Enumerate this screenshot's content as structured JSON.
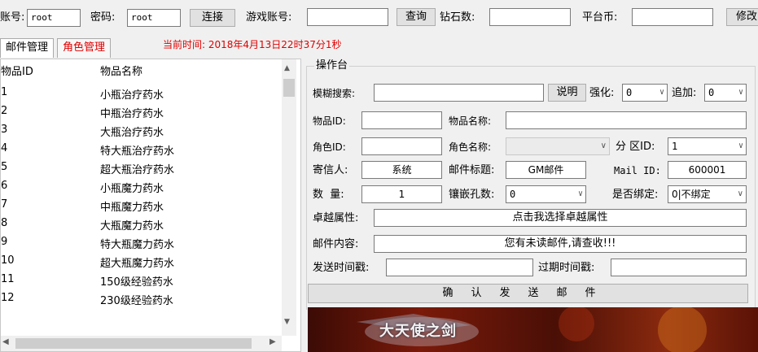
{
  "toolbar": {
    "account_label": "账号:",
    "account_value": "root",
    "password_label": "密码:",
    "password_value": "root",
    "connect_button": "连接",
    "game_account_label": "游戏账号:",
    "game_account_value": "",
    "query_button": "查询",
    "diamond_label": "钻石数:",
    "diamond_value": "",
    "platform_coin_label": "平台币:",
    "platform_coin_value": "",
    "modify_button": "修改"
  },
  "tabs": [
    {
      "label": "邮件管理",
      "active": true
    },
    {
      "label": "角色管理",
      "active": false
    }
  ],
  "current_time": "当前时间: 2018年4月13日22时37分1秒",
  "item_list": {
    "columns": [
      "物品ID",
      "物品名称"
    ],
    "rows": [
      [
        "1",
        "小瓶治疗药水"
      ],
      [
        "2",
        "中瓶治疗药水"
      ],
      [
        "3",
        "大瓶治疗药水"
      ],
      [
        "4",
        "特大瓶治疗药水"
      ],
      [
        "5",
        "超大瓶治疗药水"
      ],
      [
        "6",
        "小瓶魔力药水"
      ],
      [
        "7",
        "中瓶魔力药水"
      ],
      [
        "8",
        "大瓶魔力药水"
      ],
      [
        "9",
        "特大瓶魔力药水"
      ],
      [
        "10",
        "超大瓶魔力药水"
      ],
      [
        "11",
        "150级经验药水"
      ],
      [
        "12",
        "230级经验药水"
      ]
    ]
  },
  "ops": {
    "title": "操作台",
    "fuzzy_search_label": "模糊搜索:",
    "fuzzy_search_value": "",
    "explain_button": "说明",
    "enhance_label": "强化:",
    "enhance_value": "0",
    "append_label": "追加:",
    "append_value": "0",
    "item_id_label": "物品ID:",
    "item_id_value": "",
    "item_name_label": "物品名称:",
    "item_name_value": "",
    "role_id_label": "角色ID:",
    "role_id_value": "",
    "role_name_label": "角色名称:",
    "role_name_value": "",
    "zone_id_label": "分 区ID:",
    "zone_id_value": "1",
    "sender_label": "寄信人:",
    "sender_value": "系统",
    "mail_title_label": "邮件标题:",
    "mail_title_value": "GM邮件",
    "mail_id_label": "Mail ID:",
    "mail_id_value": "600001",
    "quantity_label": "数  量:",
    "quantity_value": "1",
    "socket_label": "镶嵌孔数:",
    "socket_value": "0",
    "bound_label": "是否绑定:",
    "bound_value": "0|不绑定",
    "excellent_label": "卓越属性:",
    "excellent_button": "点击我选择卓越属性",
    "mail_content_label": "邮件内容:",
    "mail_content_value": "您有未读邮件,请查收!!!",
    "send_time_label": "发送时间戳:",
    "send_time_value": "",
    "expire_time_label": "过期时间戳:",
    "expire_time_value": "",
    "send_button": "确认发送邮件"
  },
  "banner": {
    "logo_text": "大天使之剑"
  },
  "colors": {
    "accent_red": "#e00000",
    "window_bg": "#f0f0f0"
  }
}
